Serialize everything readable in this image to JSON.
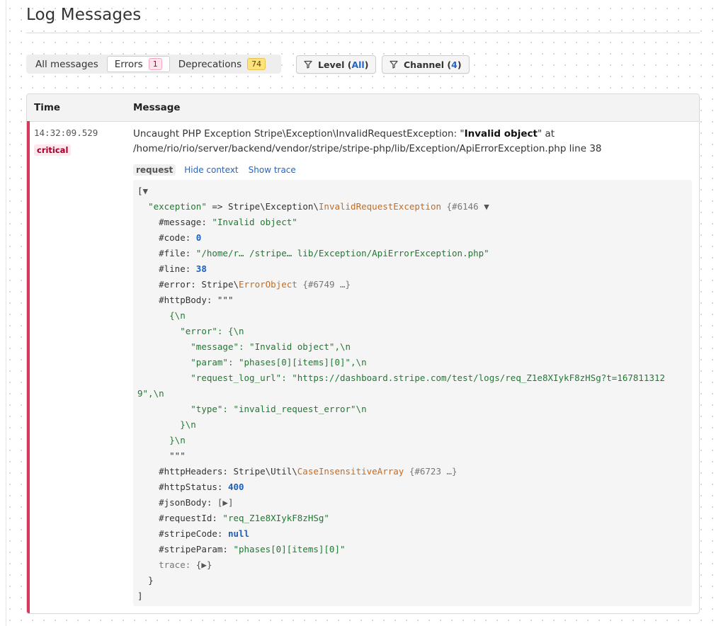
{
  "page": {
    "title": "Log Messages"
  },
  "tabs": [
    {
      "label": "All messages"
    },
    {
      "label": "Errors",
      "count": "1"
    },
    {
      "label": "Deprecations",
      "count": "74"
    }
  ],
  "filters": {
    "level": {
      "label": "Level",
      "value": "All"
    },
    "channel": {
      "label": "Channel",
      "value": "4"
    }
  },
  "table": {
    "headers": {
      "time": "Time",
      "message": "Message"
    },
    "row": {
      "time": "14:32:09.529",
      "level": "critical",
      "message_prefix": "Uncaught PHP Exception Stripe\\Exception\\InvalidRequestException: \"",
      "message_bold": "Invalid object",
      "message_suffix": "\" at /home/rio/rio/server/backend/vendor/stripe/stripe-php/lib/Exception/ApiErrorException.php line 38",
      "context_tag": "request",
      "hide_context": "Hide context",
      "show_trace": "Show trace"
    }
  },
  "dump": {
    "open_bracket": "[",
    "close_bracket": "]",
    "exception_key": "\"exception\"",
    "arrow": " => ",
    "exception_ns": "Stripe\\Exception\\",
    "exception_class": "InvalidRequestException",
    "exception_ref": " {#6146",
    "message_key": "#message: ",
    "message_val": "\"Invalid object\"",
    "code_key": "#code: ",
    "code_val": "0",
    "file_key": "#file: ",
    "file_val": "\"/home/r… /stripe… lib/Exception/ApiErrorException.php\"",
    "line_key": "#line: ",
    "line_val": "38",
    "error_key": "#error: ",
    "error_ns": "Stripe\\",
    "error_class": "ErrorObject",
    "error_ref": " {#6749 …}",
    "httpbody_key": "#httpBody: ",
    "httpbody_quotes": "\"\"\"",
    "body_lines": [
      "{\\n",
      "\"error\": {\\n",
      "\"message\": \"Invalid object\",\\n",
      "\"param\": \"phases[0][items][0]\",\\n",
      "\"request_log_url\": \"https://dashboard.stripe.com/test/logs/req_Z1e8XIykF8zHSg?t=167811312",
      "9\",\\n",
      "\"type\": \"invalid_request_error\"\\n",
      "}\\n",
      "}\\n",
      "\"\"\""
    ],
    "headers_key": "#httpHeaders: ",
    "headers_ns": "Stripe\\Util\\",
    "headers_class": "CaseInsensitiveArray",
    "headers_ref": " {#6723 …}",
    "status_key": "#httpStatus: ",
    "status_val": "400",
    "json_key": "#jsonBody: ",
    "json_val": "[▶]",
    "reqid_key": "#requestId: ",
    "reqid_val": "\"req_Z1e8XIykF8zHSg\"",
    "scode_key": "#stripeCode: ",
    "scode_val": "null",
    "sparam_key": "#stripeParam: ",
    "sparam_val": "\"phases[0][items][0]\"",
    "trace_key": "trace: ",
    "trace_val": "{▶}",
    "close_brace": "}"
  }
}
